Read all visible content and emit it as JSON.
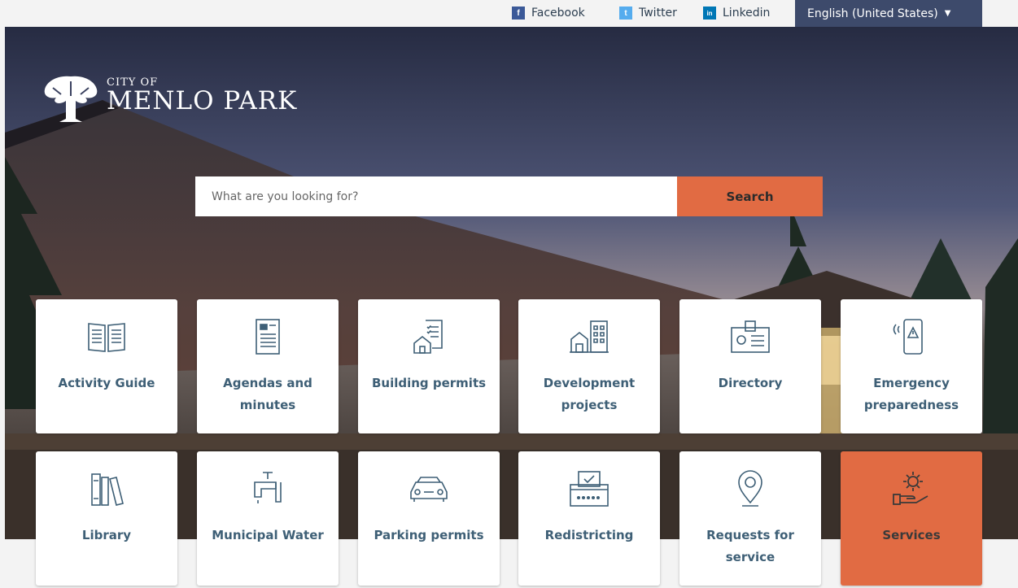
{
  "topbar": {
    "social": [
      {
        "label": "Facebook",
        "icon": "facebook-icon",
        "glyph": "f",
        "color": "#3b5998"
      },
      {
        "label": "Twitter",
        "icon": "twitter-icon",
        "glyph": "t",
        "color": "#55acee"
      },
      {
        "label": "Linkedin",
        "icon": "linkedin-icon",
        "glyph": "in",
        "color": "#0077b5"
      }
    ],
    "language": "English (United States)"
  },
  "logo": {
    "city_of": "CITY OF",
    "name": "MENLO PARK"
  },
  "search": {
    "placeholder": "What are you looking for?",
    "button": "Search"
  },
  "tiles": [
    {
      "label": "Activity Guide",
      "icon": "open-book-icon"
    },
    {
      "label": "Agendas and minutes",
      "icon": "document-icon"
    },
    {
      "label": "Building permits",
      "icon": "house-checklist-icon"
    },
    {
      "label": "Development projects",
      "icon": "buildings-icon"
    },
    {
      "label": "Directory",
      "icon": "id-badge-icon"
    },
    {
      "label": "Emergency preparedness",
      "icon": "phone-alert-icon"
    },
    {
      "label": "Library",
      "icon": "books-icon"
    },
    {
      "label": "Municipal Water",
      "icon": "faucet-icon"
    },
    {
      "label": "Parking permits",
      "icon": "car-icon"
    },
    {
      "label": "Redistricting",
      "icon": "ballot-box-icon"
    },
    {
      "label": "Requests for service",
      "icon": "map-pin-icon"
    },
    {
      "label": "Services",
      "icon": "gear-hand-icon"
    }
  ],
  "colors": {
    "accent": "#e16b43",
    "tile_text": "#3e5f76",
    "language_bar": "#3d4a6b"
  }
}
